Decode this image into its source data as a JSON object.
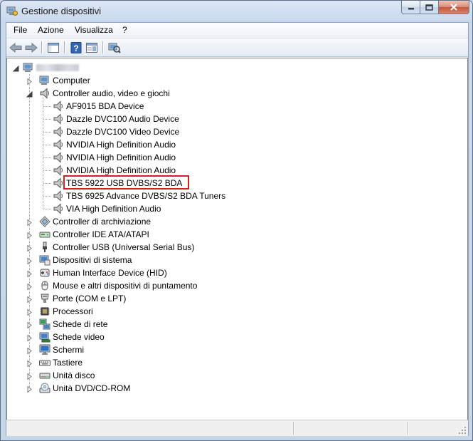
{
  "window": {
    "title": "Gestione dispositivi"
  },
  "menu": [
    "File",
    "Azione",
    "Visualizza",
    "?"
  ],
  "toolbar": [
    "back-arrow-icon",
    "forward-arrow-icon",
    "show-hide-console-tree-icon",
    "help-icon",
    "properties-icon",
    "scan-hardware-changes-icon"
  ],
  "tree": {
    "root": {
      "label": "",
      "icon": "computer-icon"
    },
    "categories": [
      {
        "label": "Computer",
        "icon": "computer-icon",
        "expanded": false
      },
      {
        "label": "Controller audio, video e giochi",
        "icon": "speaker-icon",
        "expanded": true,
        "children": [
          "AF9015 BDA Device",
          "Dazzle DVC100 Audio Device",
          "Dazzle DVC100 Video Device",
          "NVIDIA High Definition Audio",
          "NVIDIA High Definition Audio",
          "NVIDIA High Definition Audio",
          "TBS 5922 USB DVBS/S2 BDA",
          "TBS 6925 Advance DVBS/S2 BDA Tuners",
          "VIA High Definition Audio"
        ],
        "highlighted_child": 6
      },
      {
        "label": "Controller di archiviazione",
        "icon": "storage-controller-icon",
        "expanded": false
      },
      {
        "label": "Controller IDE ATA/ATAPI",
        "icon": "ide-controller-icon",
        "expanded": false
      },
      {
        "label": "Controller USB (Universal Serial Bus)",
        "icon": "usb-icon",
        "expanded": false
      },
      {
        "label": "Dispositivi di sistema",
        "icon": "system-device-icon",
        "expanded": false
      },
      {
        "label": "Human Interface Device (HID)",
        "icon": "hid-icon",
        "expanded": false
      },
      {
        "label": "Mouse e altri dispositivi di puntamento",
        "icon": "mouse-icon",
        "expanded": false
      },
      {
        "label": "Porte (COM e LPT)",
        "icon": "port-icon",
        "expanded": false
      },
      {
        "label": "Processori",
        "icon": "processor-icon",
        "expanded": false
      },
      {
        "label": "Schede di rete",
        "icon": "network-adapter-icon",
        "expanded": false
      },
      {
        "label": "Schede video",
        "icon": "display-adapter-icon",
        "expanded": false
      },
      {
        "label": "Schermi",
        "icon": "monitor-icon",
        "expanded": false
      },
      {
        "label": "Tastiere",
        "icon": "keyboard-icon",
        "expanded": false
      },
      {
        "label": "Unità disco",
        "icon": "disk-drive-icon",
        "expanded": false
      },
      {
        "label": "Unità DVD/CD-ROM",
        "icon": "dvd-drive-icon",
        "expanded": false
      }
    ]
  },
  "colors": {
    "highlight_border": "#d42020",
    "selection": "#cce8ff"
  }
}
